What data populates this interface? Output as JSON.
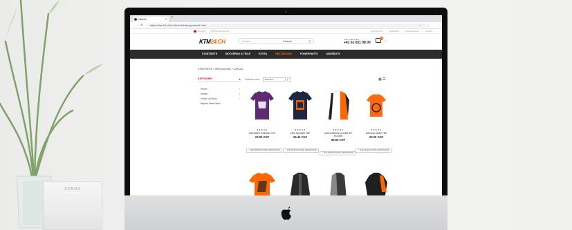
{
  "scene": {
    "speaker_brand": "SONOS"
  },
  "browser": {
    "tab_title": "Casual",
    "url": "https://ktm24.ch/ch/de/bekleidung/casual.html"
  },
  "site": {
    "topbar": {
      "language": "Deutsch",
      "b2b": "B2B Kundenbereich",
      "links": [
        "Unternehmen",
        "Newsletter",
        "Versandkosten",
        "Kontakt"
      ]
    },
    "logo": {
      "main": "KTM",
      "accent": "24.CH"
    },
    "search": {
      "placeholder": "Suche...",
      "value": "Casual"
    },
    "phone_label": "Hilfe & Beratung",
    "phone": "+41 61 811 08 00",
    "cart_count": "0",
    "nav": [
      "STARTSEITE",
      "MOTORRAD & TEILE",
      "EXTRA",
      "BEKLEIDUNG",
      "POWERPARTS",
      "ANGEBOTE"
    ],
    "nav_active_index": 3,
    "breadcrumb": "STARTSEITE  >  BEKLEIDUNG  >  CASUAL",
    "sidebar": {
      "title": "KATEGORIE",
      "filters": [
        "Herren",
        "Damen",
        "Kinder und Baby",
        "Beyond Street Wear"
      ]
    },
    "sort": {
      "label": "Sortieren nach",
      "value": "Relevanz"
    },
    "products": [
      {
        "name": "RACEGIRL RADICAL TEE",
        "price": "23.00 CHF",
        "stars": "★★★★★",
        "wish": "ZUR WUNSCHLISTE HINZUFÜGEN"
      },
      {
        "name": "KIDS SQUARE TEE",
        "price": "34.40 CHF",
        "stars": "★★★★★",
        "wish": "ZUR WUNSCHLISTE HINZUFÜGEN"
      },
      {
        "name": "KIDS RADICAL SLIVER ZIP HOODIE",
        "price": "69.65 CHF",
        "stars": "★★★★★",
        "wish": "ZUR WUNSCHLISTE HINZUFÜGEN"
      },
      {
        "name": "RADICAL BABY TEE",
        "price": "23.00 CHF",
        "stars": "★★★★★",
        "wish": "ZUR WUNSCHLISTE HINZUFÜGEN"
      }
    ]
  },
  "colors": {
    "brand_orange": "#ff6600",
    "nav_bg": "#2b2b2b",
    "accent_red": "#e30613"
  }
}
